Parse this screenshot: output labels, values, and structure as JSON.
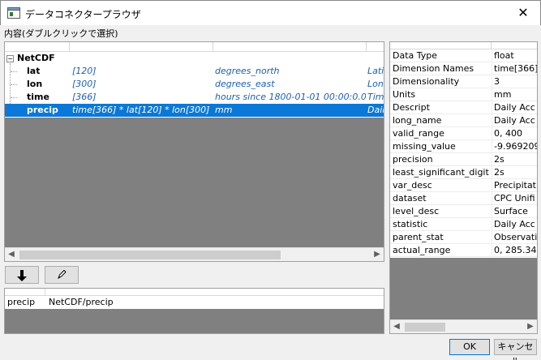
{
  "window": {
    "title": "データコネクタープラウザ",
    "close_glyph": "✕"
  },
  "content_label": "内容(ダブルクリックで選択)",
  "tree": {
    "root": {
      "toggle": "−",
      "label": "NetCDF"
    },
    "rows": [
      {
        "name": "lat",
        "dims": "[120]",
        "units": "degrees_north",
        "desc": "Latit"
      },
      {
        "name": "lon",
        "dims": "[300]",
        "units": "degrees_east",
        "desc": "Longi"
      },
      {
        "name": "time",
        "dims": "[366]",
        "units": "hours since 1800-01-01 00:00:0.0",
        "desc": "Time"
      },
      {
        "name": "precip",
        "dims": "time[366] * lat[120] * lon[300]",
        "units": "mm",
        "desc": "Daily",
        "selected": true
      }
    ]
  },
  "toolbar": {
    "add_icon": "down-arrow-icon",
    "edit_icon": "pencil-icon"
  },
  "destination": {
    "name": "precip",
    "path": "NetCDF/precip"
  },
  "properties": [
    {
      "key": "Data Type",
      "value": "float"
    },
    {
      "key": "Dimension Names",
      "value": "time[366]"
    },
    {
      "key": "Dimensionality",
      "value": "3"
    },
    {
      "key": "Units",
      "value": "mm"
    },
    {
      "key": "Descript",
      "value": "Daily Acc"
    },
    {
      "key": "long_name",
      "value": "Daily Acc"
    },
    {
      "key": "valid_range",
      "value": "0, 400"
    },
    {
      "key": "missing_value",
      "value": "-9.969209"
    },
    {
      "key": "precision",
      "value": "2s"
    },
    {
      "key": "least_significant_digit",
      "value": "2s"
    },
    {
      "key": "var_desc",
      "value": "Precipitat"
    },
    {
      "key": "dataset",
      "value": "CPC Unifi"
    },
    {
      "key": "level_desc",
      "value": "Surface"
    },
    {
      "key": "statistic",
      "value": "Daily Acc"
    },
    {
      "key": "parent_stat",
      "value": "Observatio"
    },
    {
      "key": "actual_range",
      "value": "0, 285.345"
    }
  ],
  "buttons": {
    "ok": "OK",
    "cancel": "キャンセル"
  },
  "colors": {
    "selection": "#0b78d7",
    "italic_text": "#1a5fb4"
  }
}
